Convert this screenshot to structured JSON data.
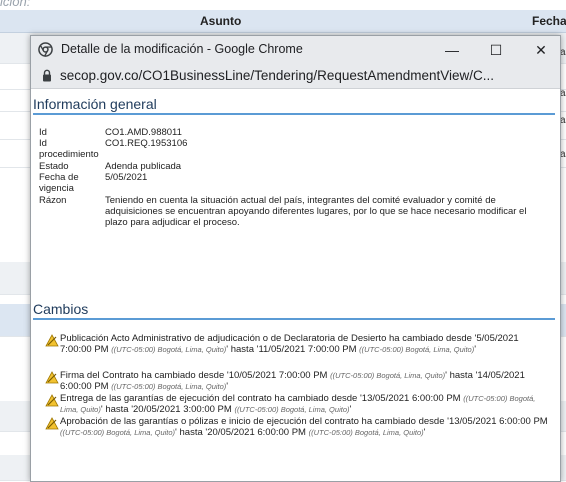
{
  "background": {
    "top_text": "ición:",
    "header": {
      "asunto": "Asunto",
      "fecha": "Fecha"
    },
    "row_snippets": [
      "as",
      "as",
      "as",
      "as"
    ]
  },
  "window": {
    "title": "Detalle de la modificación - Google Chrome",
    "controls": {
      "minimize": "—",
      "maximize": "☐",
      "close": "✕"
    },
    "url": "secop.gov.co/CO1BusinessLine/Tendering/RequestAmendmentView/C..."
  },
  "info": {
    "heading": "Información general",
    "fields": [
      {
        "label": "Id",
        "value": "CO1.AMD.988011"
      },
      {
        "label": "Id procedimiento",
        "value": "CO1.REQ.1953106"
      },
      {
        "label": "Estado",
        "value": "Adenda publicada"
      },
      {
        "label": "Fecha de vigencia",
        "value": "5/05/2021"
      },
      {
        "label": "Rázon",
        "value": "Teniendo en cuenta la situación actual del país, integrantes del comité evaluador y comité de adquisiciones se encuentran apoyando diferentes lugares, por lo que se hace necesario modificar el plazo para adjudicar el proceso."
      }
    ]
  },
  "changes": {
    "heading": "Cambios",
    "timezone": "(UTC-05:00) Bogotá, Lima, Quito",
    "items": [
      {
        "prefix": "Publicación Acto Administrativo de adjudicación o de Declaratoria de Desierto ha cambiado desde '",
        "from": "5/05/2021 7:00:00 PM",
        "middle": "' hasta '",
        "to": "11/05/2021 7:00:00 PM"
      },
      {
        "prefix": "Firma del Contrato ha cambiado desde '",
        "from": "10/05/2021 7:00:00 PM",
        "middle": "' hasta '",
        "to": "14/05/2021 6:00:00 PM"
      },
      {
        "prefix": "Entrega de las garantías de ejecución del contrato ha cambiado desde '",
        "from": "13/05/2021 6:00:00 PM",
        "middle": "' hasta '",
        "to": "20/05/2021 3:00:00 PM"
      },
      {
        "prefix": "Aprobación de las garantías o pólizas e inicio de ejecución del contrato ha cambiado desde '",
        "from": "13/05/2021 6:00:00 PM",
        "middle": "' hasta '",
        "to": "20/05/2021 6:00:00 PM"
      }
    ]
  },
  "colors": {
    "accent_line": "#5b9bd5",
    "heading_text": "#1f3b5c",
    "warning_icon": "#e0a800"
  }
}
